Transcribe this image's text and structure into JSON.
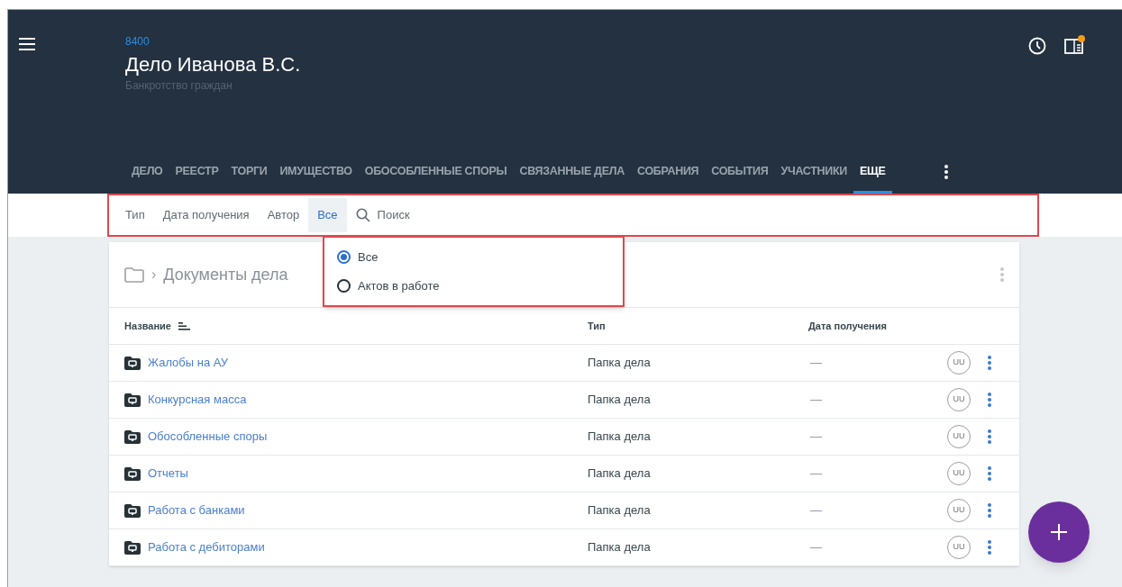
{
  "header": {
    "case_number": "8400",
    "title": "Дело Иванова В.С.",
    "subtitle": "Банкротство граждан",
    "notification": true
  },
  "tabs": [
    {
      "label": "ДЕЛО",
      "selected": false
    },
    {
      "label": "РЕЕСТР",
      "selected": false
    },
    {
      "label": "ТОРГИ",
      "selected": false
    },
    {
      "label": "ИМУЩЕСТВО",
      "selected": false
    },
    {
      "label": "ОБОСОБЛЕННЫЕ СПОРЫ",
      "selected": false
    },
    {
      "label": "СВЯЗАННЫЕ ДЕЛА",
      "selected": false
    },
    {
      "label": "СОБРАНИЯ",
      "selected": false
    },
    {
      "label": "СОБЫТИЯ",
      "selected": false
    },
    {
      "label": "УЧАСТНИКИ",
      "selected": false
    },
    {
      "label": "ЕЩЕ",
      "selected": true
    }
  ],
  "filters": [
    {
      "label": "Тип",
      "selected": false
    },
    {
      "label": "Дата получения",
      "selected": false
    },
    {
      "label": "Автор",
      "selected": false
    },
    {
      "label": "Все",
      "selected": true
    }
  ],
  "search": {
    "placeholder": "Поиск"
  },
  "dropdown": {
    "options": [
      {
        "label": "Все",
        "selected": true
      },
      {
        "label": "Актов в работе",
        "selected": false
      }
    ]
  },
  "breadcrumb": {
    "separator": "›",
    "current": "Документы дела"
  },
  "table": {
    "columns": [
      "Название",
      "Тип",
      "Дата получения"
    ],
    "rows": [
      {
        "name": "Жалобы на АУ",
        "type": "Папка дела",
        "date": "—",
        "author": "UU"
      },
      {
        "name": "Конкурсная масса",
        "type": "Папка дела",
        "date": "—",
        "author": "UU"
      },
      {
        "name": "Обособленные споры",
        "type": "Папка дела",
        "date": "—",
        "author": "UU"
      },
      {
        "name": "Отчеты",
        "type": "Папка дела",
        "date": "—",
        "author": "UU"
      },
      {
        "name": "Работа с банками",
        "type": "Папка дела",
        "date": "—",
        "author": "UU"
      },
      {
        "name": "Работа с дебиторами",
        "type": "Папка дела",
        "date": "—",
        "author": "UU"
      }
    ]
  }
}
